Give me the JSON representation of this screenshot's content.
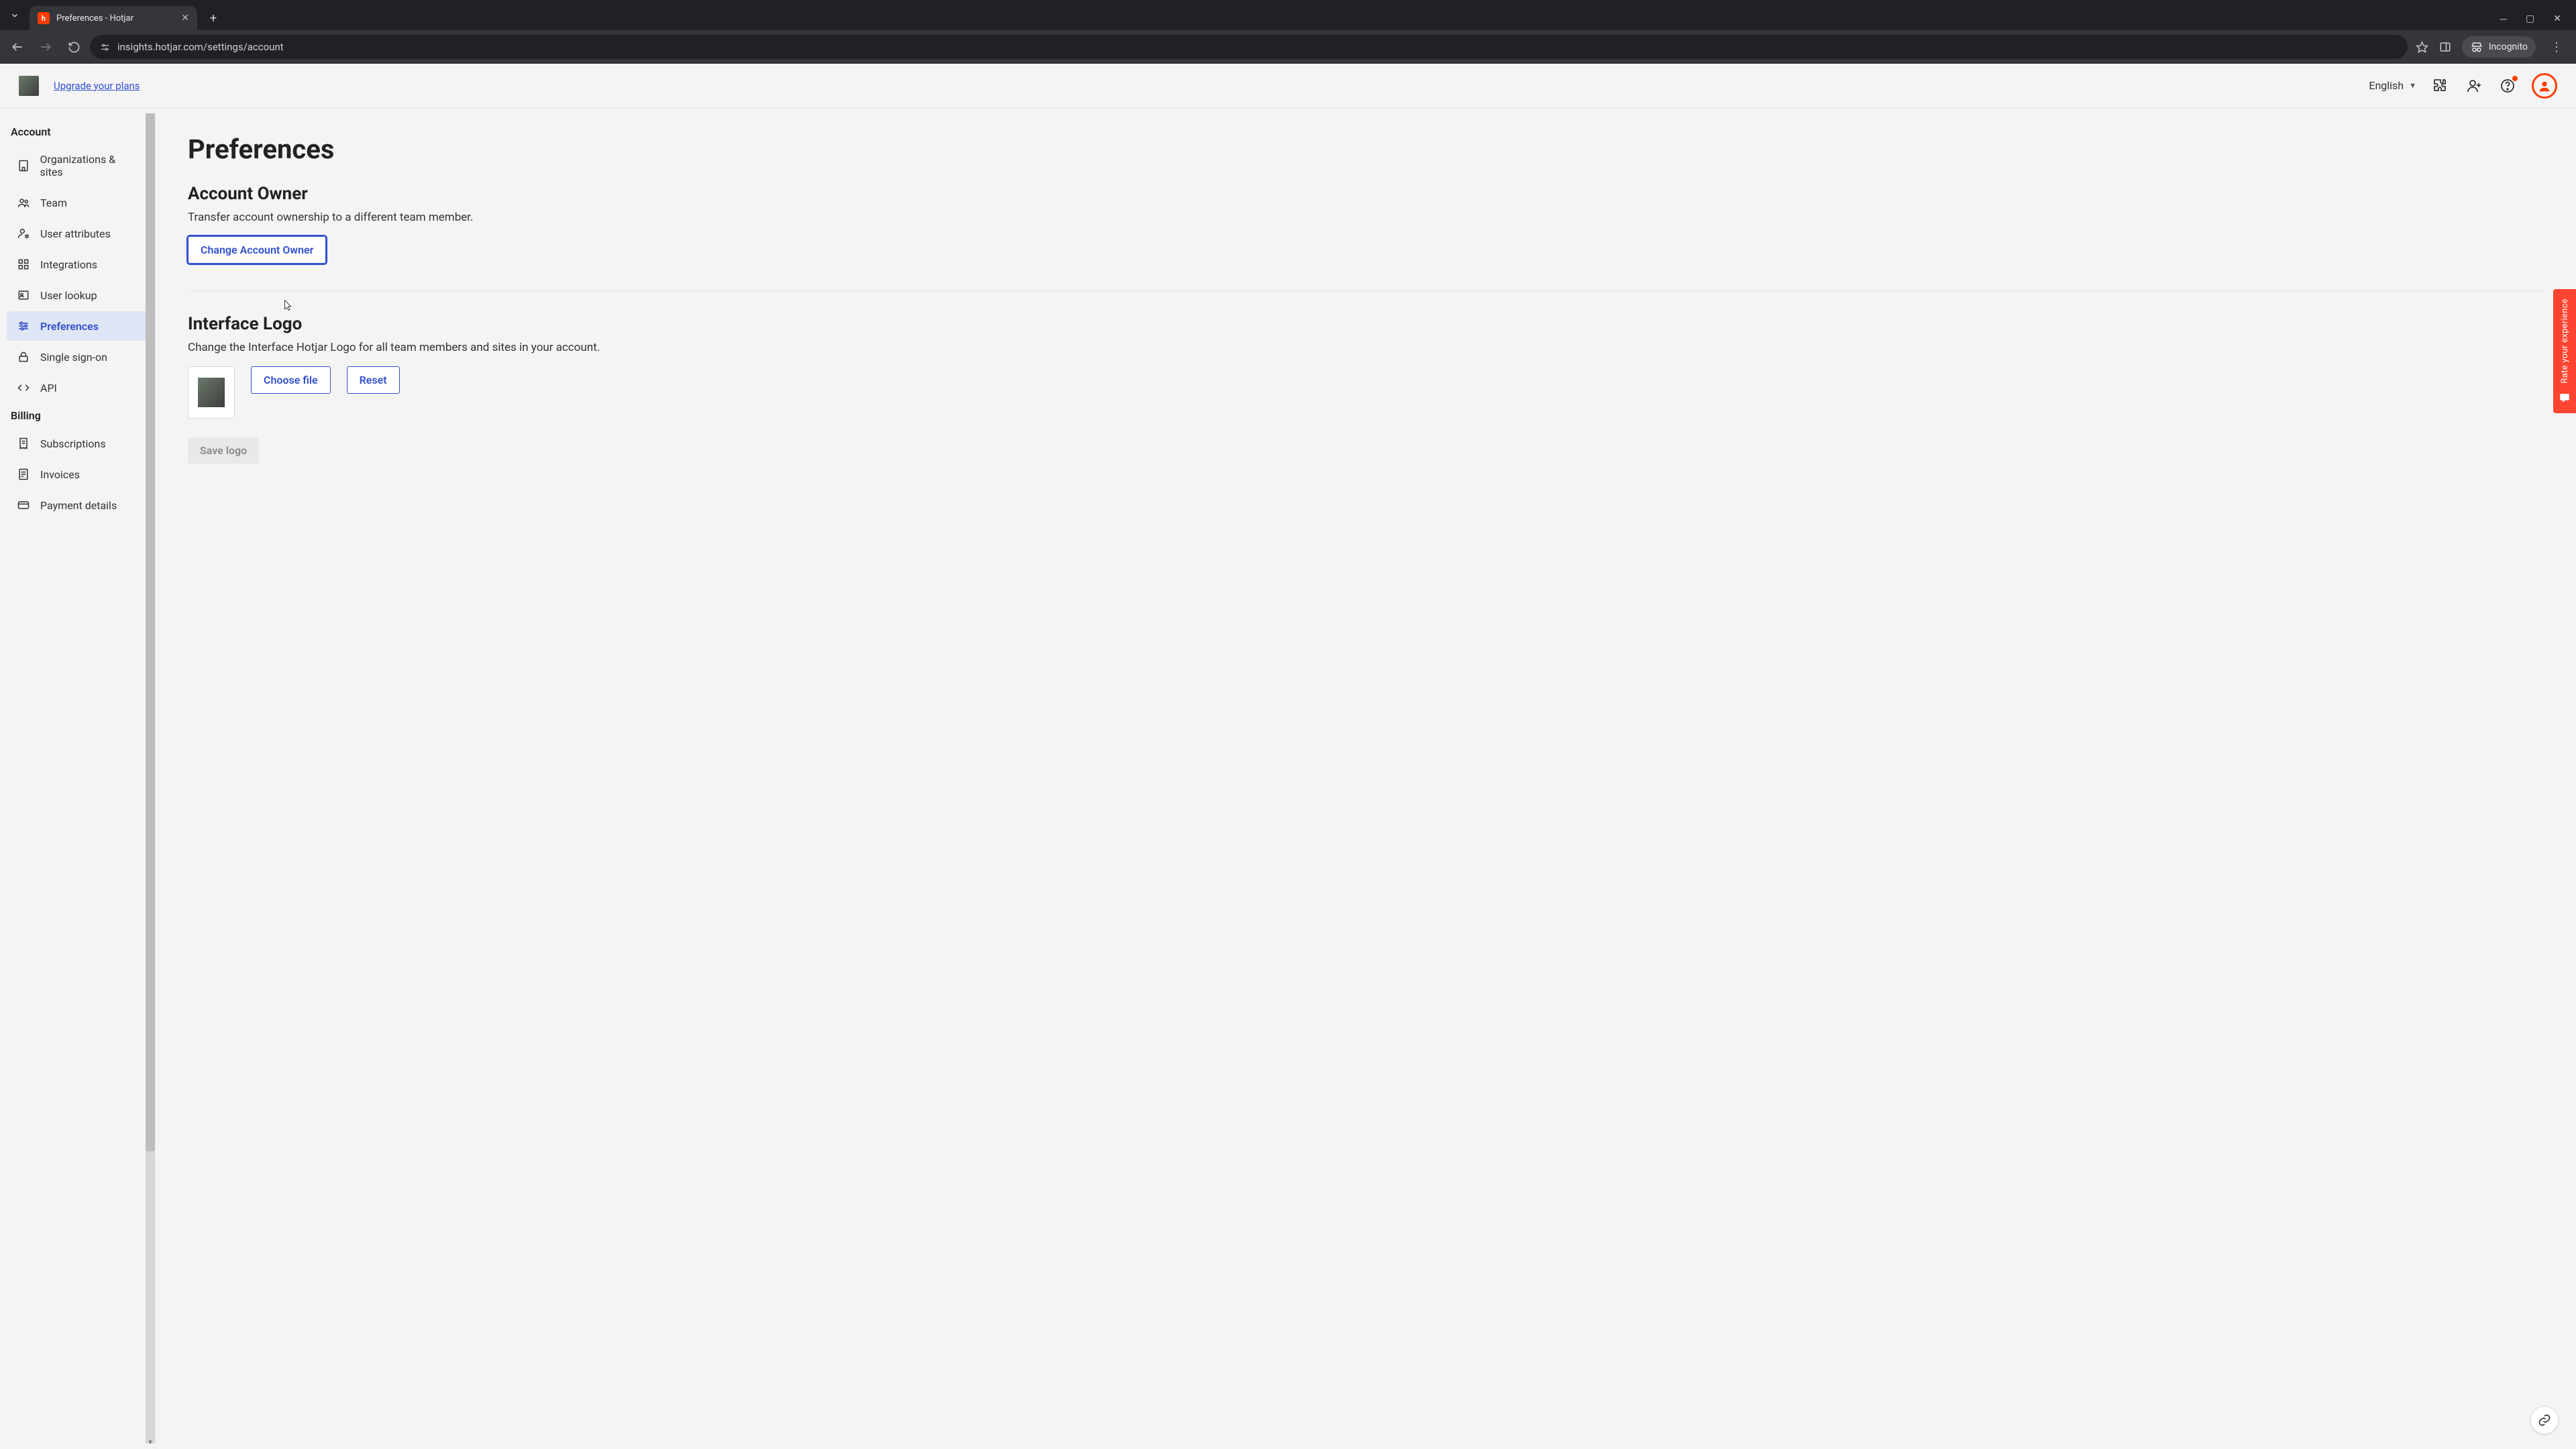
{
  "browser": {
    "tab_title": "Preferences - Hotjar",
    "url": "insights.hotjar.com/settings/account",
    "incognito_label": "Incognito"
  },
  "topbar": {
    "upgrade": "Upgrade your plans",
    "language": "English"
  },
  "sidebar": {
    "section_account": "Account",
    "section_billing": "Billing",
    "items": {
      "orgs": "Organizations & sites",
      "team": "Team",
      "attrs": "User attributes",
      "integrations": "Integrations",
      "lookup": "User lookup",
      "prefs": "Preferences",
      "sso": "Single sign-on",
      "api": "API",
      "subs": "Subscriptions",
      "invoices": "Invoices",
      "payment": "Payment details"
    }
  },
  "main": {
    "title": "Preferences",
    "owner_title": "Account Owner",
    "owner_desc": "Transfer account ownership to a different team member.",
    "owner_btn": "Change Account Owner",
    "logo_title": "Interface Logo",
    "logo_desc": "Change the Interface Hotjar Logo for all team members and sites in your account.",
    "choose_file": "Choose file",
    "reset": "Reset",
    "save_logo": "Save logo"
  },
  "feedback": {
    "label": "Rate your experience"
  }
}
